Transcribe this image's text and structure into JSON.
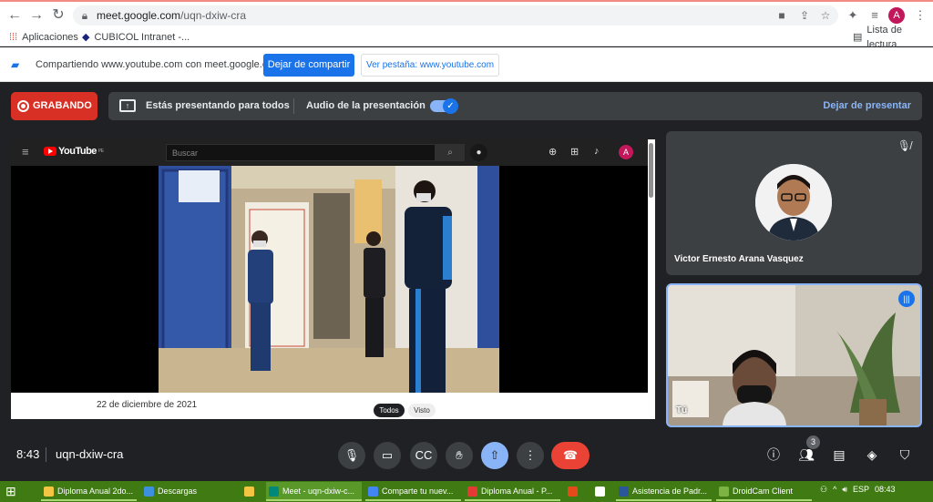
{
  "browser": {
    "url_host": "meet.google.com",
    "url_path": "/uqn-dxiw-cra",
    "avatar_letter": "A",
    "bookmarks": [
      {
        "label": "Aplicaciones"
      },
      {
        "label": "CUBICOL Intranet -..."
      }
    ],
    "reading_list": "Lista de lectura"
  },
  "sharebar": {
    "text": "Compartiendo www.youtube.com con meet.google.com",
    "stop_button": "Dejar de compartir",
    "view_tab_button": "Ver pestaña: www.youtube.com"
  },
  "meet": {
    "recording_label": "GRABANDO",
    "presenting_text": "Estás presentando para todos",
    "audio_text": "Audio de la presentación",
    "stop_presenting": "Dejar de presentar",
    "time": "8:43",
    "meeting_code": "uqn-dxiw-cra",
    "people_count": "3",
    "participants": [
      {
        "name": "Victor Ernesto Arana Vasquez"
      },
      {
        "name": "Tú"
      }
    ]
  },
  "youtube": {
    "logo_text": "YouTube",
    "logo_sup": "PE",
    "search_placeholder": "Buscar",
    "avatar_letter": "A",
    "date": "22 de diciembre de 2021",
    "chips": [
      "Todos",
      "Visto"
    ]
  },
  "taskbar": {
    "items": [
      {
        "label": "Diploma Anual 2do...",
        "color": "#f4c542"
      },
      {
        "label": "Descargas",
        "color": "#3d8fe0"
      },
      {
        "label": "",
        "color": "#f4c542"
      },
      {
        "label": "Meet - uqn-dxiw-c...",
        "color": "#00897b"
      },
      {
        "label": "Comparte tu nuev...",
        "color": "#4285f4"
      },
      {
        "label": "Diploma Anual - P...",
        "color": "#e53935"
      },
      {
        "label": "",
        "color": "#e64a19"
      },
      {
        "label": "",
        "color": "#ffffff"
      },
      {
        "label": "Asistencia de Padr...",
        "color": "#2b579a"
      },
      {
        "label": "DroidCam Client",
        "color": "#7cb342"
      }
    ],
    "lang": "ESP",
    "time": "08:43"
  }
}
